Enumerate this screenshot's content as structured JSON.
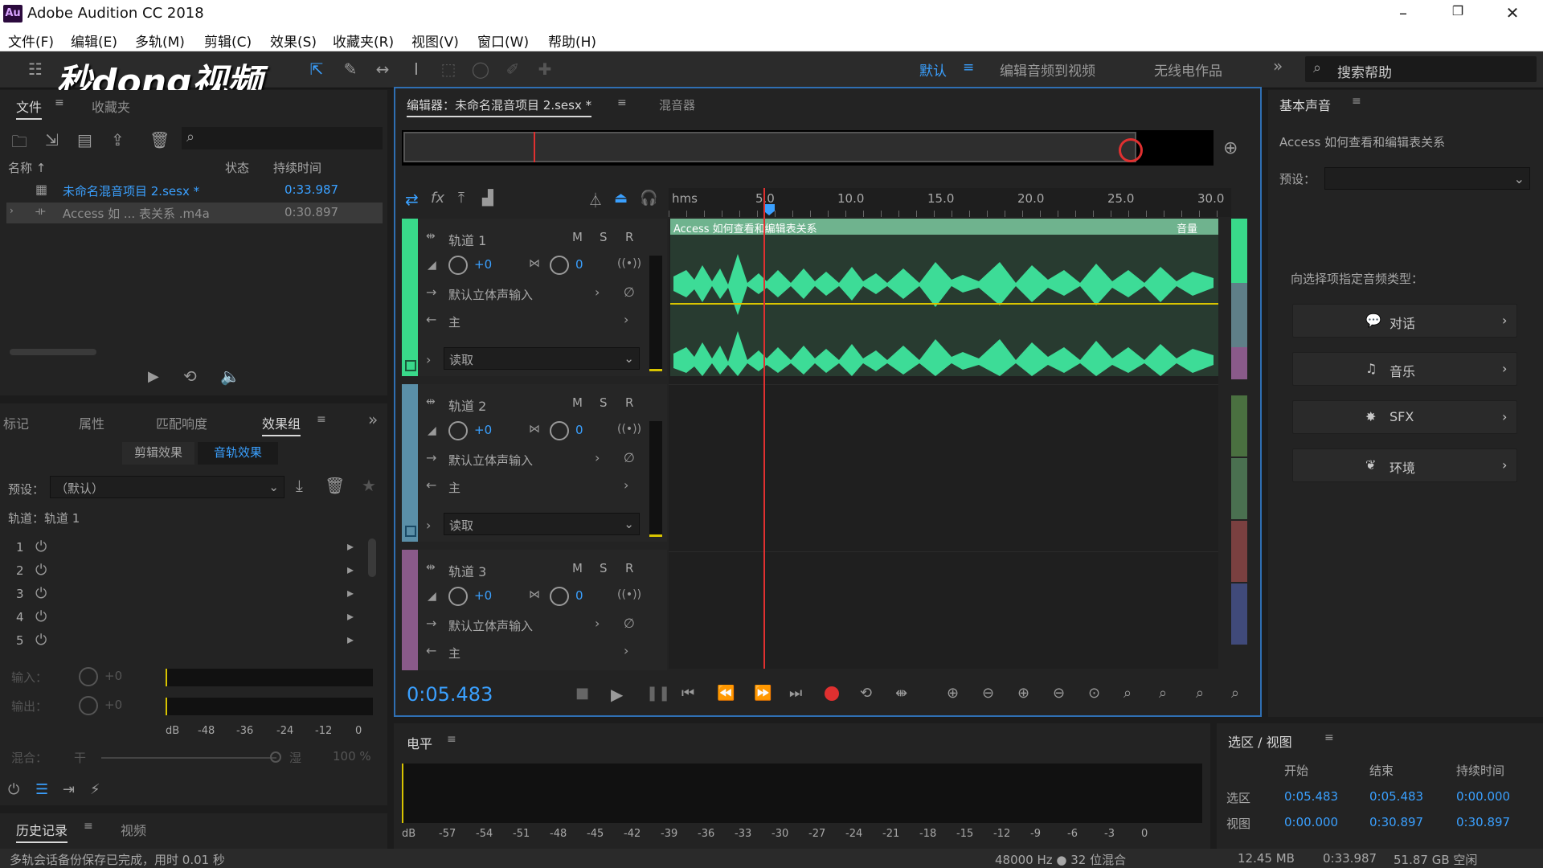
{
  "window": {
    "app_title": "Adobe Audition CC 2018",
    "logo_text": "Au"
  },
  "menu": [
    "文件(F)",
    "编辑(E)",
    "多轨(M)",
    "剪辑(C)",
    "效果(S)",
    "收藏夹(R)",
    "视图(V)",
    "窗口(W)",
    "帮助(H)"
  ],
  "watermark": "秒dong视频",
  "workspaces": {
    "default": "默认",
    "edit_to_video": "编辑音频到视频",
    "radio": "无线电作品"
  },
  "search": {
    "placeholder": "搜索帮助"
  },
  "files_panel": {
    "tab_files": "文件",
    "tab_favorites": "收藏夹",
    "col_name": "名称 ↑",
    "col_status": "状态",
    "col_duration": "持续时间",
    "rows": [
      {
        "name": "未命名混音项目 2.sesx *",
        "duration": "0:33.987"
      },
      {
        "name": "Access 如 ... 表关系 .m4a",
        "duration": "0:30.897"
      }
    ]
  },
  "effects_panel": {
    "tabs": [
      "标记",
      "属性",
      "匹配响度",
      "效果组"
    ],
    "sub_clip": "剪辑效果",
    "sub_track": "音轨效果",
    "preset_label": "预设：",
    "preset_value": "（默认）",
    "track_label": "轨道：轨道 1",
    "slots": [
      "1",
      "2",
      "3",
      "4",
      "5"
    ],
    "input_label": "输入：",
    "input_val": "+0",
    "output_label": "输出：",
    "output_val": "+0",
    "scale": [
      "dB",
      "-48",
      "-36",
      "-24",
      "-12",
      "0"
    ],
    "mix_label": "混合：",
    "mix_dry": "干",
    "mix_wet": "湿",
    "mix_pct": "100 %"
  },
  "history_panel": {
    "tab_history": "历史记录",
    "tab_video": "视频"
  },
  "editor": {
    "tab_title": "编辑器：未命名混音项目 2.sesx *",
    "tab_mixer": "混音器",
    "ruler": [
      "hms",
      "5.0",
      "10.0",
      "15.0",
      "20.0",
      "25.0",
      "30.0"
    ],
    "clip_title": "Access 如何查看和编辑表关系",
    "clip_volume": "音量",
    "tracks": [
      {
        "name": "轨道 1",
        "vol": "+0",
        "pan": "0",
        "input": "默认立体声输入",
        "output": "主",
        "mode": "读取"
      },
      {
        "name": "轨道 2",
        "vol": "+0",
        "pan": "0",
        "input": "默认立体声输入",
        "output": "主",
        "mode": "读取"
      },
      {
        "name": "轨道 3",
        "vol": "+0",
        "pan": "0",
        "input": "默认立体声输入",
        "output": "主"
      }
    ],
    "msr": [
      "M",
      "S",
      "R"
    ],
    "time": "0:05.483"
  },
  "levels_panel": {
    "title": "电平",
    "scale": [
      "dB",
      "-57",
      "-54",
      "-51",
      "-48",
      "-45",
      "-42",
      "-39",
      "-36",
      "-33",
      "-30",
      "-27",
      "-24",
      "-21",
      "-18",
      "-15",
      "-12",
      "-9",
      "-6",
      "-3",
      "0"
    ]
  },
  "essential_sound": {
    "title": "基本声音",
    "clip": "Access 如何查看和编辑表关系",
    "preset_label": "预设：",
    "prompt": "向选择项指定音频类型：",
    "buttons": [
      "对话",
      "音乐",
      "SFX",
      "环境"
    ]
  },
  "selection_view": {
    "title": "选区 / 视图",
    "headers": [
      "开始",
      "结束",
      "持续时间"
    ],
    "rows": [
      {
        "label": "选区",
        "start": "0:05.483",
        "end": "0:05.483",
        "duration": "0:00.000"
      },
      {
        "label": "视图",
        "start": "0:00.000",
        "end": "0:30.897",
        "duration": "0:30.897"
      }
    ]
  },
  "status": {
    "left": "多轨会话备份保存已完成，用时 0.01 秒",
    "format": "48000 Hz ● 32 位混合",
    "size": "12.45 MB",
    "duration": "0:33.987",
    "free": "51.87 GB 空闲"
  },
  "colors": {
    "accent": "#3aa0ff",
    "waveform": "#3ddc97",
    "track1": "#39d98a",
    "track2": "#5a8fa8",
    "track3": "#8a5a8a",
    "playhead": "#e03030"
  }
}
